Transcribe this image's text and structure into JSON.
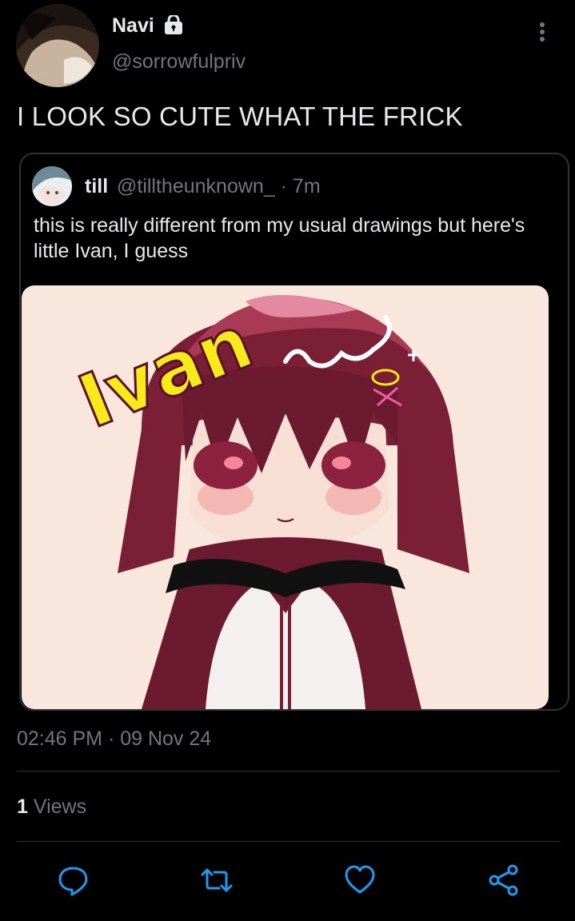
{
  "author": {
    "name": "Navi",
    "handle": "@sorrowfulpriv",
    "protected_icon": "lock-icon"
  },
  "tweet": {
    "text": "I LOOK SO CUTE WHAT THE FRICK"
  },
  "quoted": {
    "name": "till",
    "handle_time": "@tilltheunknown_ · 7m",
    "text": "this is really different from my usual drawings but here's little Ivan, I guess",
    "image_caption_text": "Ivan"
  },
  "meta": {
    "timestamp": "02:46 PM · 09 Nov 24",
    "views_count": "1",
    "views_label": "Views"
  },
  "actions": [
    "reply-icon",
    "retweet-icon",
    "like-icon",
    "share-icon"
  ],
  "colors": {
    "background": "#000000",
    "text": "#e7e9ea",
    "muted": "#71767b",
    "border": "#2f3336"
  }
}
